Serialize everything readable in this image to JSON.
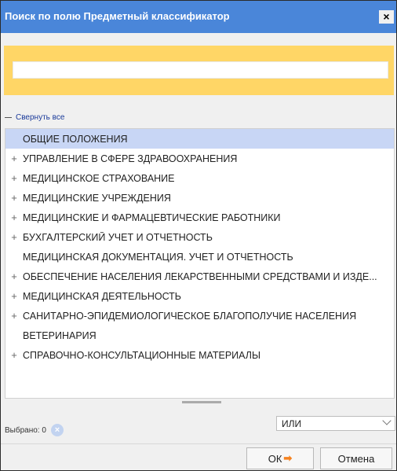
{
  "window": {
    "title": "Поиск по полю Предметный классификатор",
    "close_icon": "×"
  },
  "search": {
    "value": "",
    "placeholder": ""
  },
  "tree_toolbar": {
    "collapse_all_label": "Свернуть все"
  },
  "tree": {
    "items": [
      {
        "label": "ОБЩИЕ ПОЛОЖЕНИЯ",
        "expandable": false,
        "selected": true
      },
      {
        "label": "УПРАВЛЕНИЕ В СФЕРЕ ЗДРАВООХРАНЕНИЯ",
        "expandable": true,
        "selected": false
      },
      {
        "label": "МЕДИЦИНСКОЕ СТРАХОВАНИЕ",
        "expandable": true,
        "selected": false
      },
      {
        "label": "МЕДИЦИНСКИЕ УЧРЕЖДЕНИЯ",
        "expandable": true,
        "selected": false
      },
      {
        "label": "МЕДИЦИНСКИЕ И ФАРМАЦЕВТИЧЕСКИЕ РАБОТНИКИ",
        "expandable": true,
        "selected": false
      },
      {
        "label": "БУХГАЛТЕРСКИЙ УЧЕТ И ОТЧЕТНОСТЬ",
        "expandable": true,
        "selected": false
      },
      {
        "label": "МЕДИЦИНСКАЯ ДОКУМЕНТАЦИЯ. УЧЕТ И ОТЧЕТНОСТЬ",
        "expandable": false,
        "selected": false
      },
      {
        "label": "ОБЕСПЕЧЕНИЕ НАСЕЛЕНИЯ ЛЕКАРСТВЕННЫМИ СРЕДСТВАМИ И ИЗДЕ...",
        "expandable": true,
        "selected": false
      },
      {
        "label": "МЕДИЦИНСКАЯ ДЕЯТЕЛЬНОСТЬ",
        "expandable": true,
        "selected": false
      },
      {
        "label": "САНИТАРНО-ЭПИДЕМИОЛОГИЧЕСКОЕ БЛАГОПОЛУЧИЕ НАСЕЛЕНИЯ",
        "expandable": true,
        "selected": false
      },
      {
        "label": "ВЕТЕРИНАРИЯ",
        "expandable": false,
        "selected": false
      },
      {
        "label": "СПРАВОЧНО-КОНСУЛЬТАЦИОННЫЕ МАТЕРИАЛЫ",
        "expandable": true,
        "selected": false
      }
    ]
  },
  "status": {
    "selected_label": "Выбрано: 0",
    "clear_icon": "×"
  },
  "operator": {
    "value": "ИЛИ"
  },
  "buttons": {
    "ok_label": "ОК",
    "ok_icon": "➡",
    "cancel_label": "Отмена"
  },
  "colors": {
    "titlebar": "#4a86d9",
    "search_band": "#ffd666",
    "selection": "#c8d6f5",
    "accent_arrow": "#f58220"
  },
  "icons": {
    "close": "close-icon",
    "collapse": "minus-icon",
    "expand": "plus-icon",
    "clear": "clear-icon",
    "dropdown": "chevron-down-icon",
    "ok": "arrow-right-icon"
  }
}
